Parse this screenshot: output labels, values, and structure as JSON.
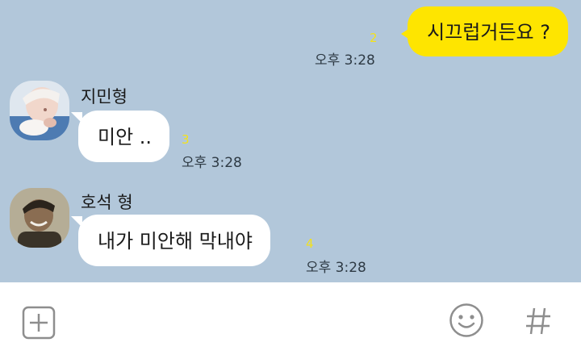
{
  "messages": {
    "outgoing": {
      "text": "시끄럽거든요 ?",
      "read_count": "2",
      "time": "오후 3:28"
    },
    "incoming": [
      {
        "sender": "지민형",
        "text": "미안 ..",
        "read_count": "3",
        "time": "오후 3:28"
      },
      {
        "sender": "호석 형",
        "text": "내가 미안해 막내야",
        "read_count": "4",
        "time": "오후 3:28"
      }
    ]
  },
  "input_bar": {
    "icons": [
      "plus-square-icon",
      "emoji-smile-icon",
      "hashtag-icon"
    ]
  },
  "colors": {
    "chat_background": "#b2c7da",
    "outgoing_bubble": "#fee500",
    "incoming_bubble": "#ffffff",
    "read_count": "#f4e21a",
    "input_bar": "#ffffff"
  }
}
